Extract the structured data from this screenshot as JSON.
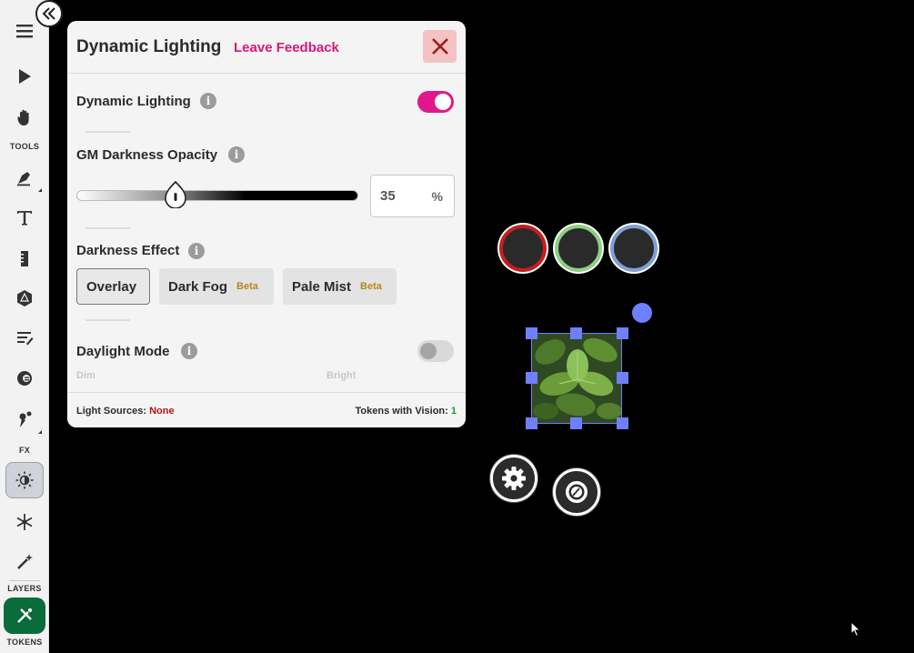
{
  "toolbar": {
    "labels": {
      "tools": "TOOLS",
      "fx": "FX",
      "layers": "LAYERS",
      "tokens": "TOKENS"
    }
  },
  "panel": {
    "title": "Dynamic Lighting",
    "feedback": "Leave Feedback",
    "info_glyph": "i",
    "dynamic_lighting": {
      "label": "Dynamic Lighting",
      "enabled": true
    },
    "gm_opacity": {
      "label": "GM Darkness Opacity",
      "value": "35",
      "unit": "%",
      "fraction": 0.35
    },
    "darkness_effect": {
      "label": "Darkness Effect",
      "options": [
        {
          "label": "Overlay",
          "badge": "",
          "selected": true
        },
        {
          "label": "Dark Fog",
          "badge": "Beta",
          "selected": false
        },
        {
          "label": "Pale Mist",
          "badge": "Beta",
          "selected": false
        }
      ]
    },
    "daylight": {
      "label": "Daylight Mode",
      "enabled": false,
      "dim": "Dim",
      "bright": "Bright"
    },
    "footer": {
      "light_sources_label": "Light Sources:",
      "light_sources_value": "None",
      "tokens_vision_label": "Tokens with Vision:",
      "tokens_vision_value": "1"
    }
  },
  "colors": {
    "accent_pink": "#e0198a",
    "feedback_pink": "#d8187a",
    "close_bg": "#f4c2c3",
    "close_x": "#9b1c1c",
    "beta_gold": "#b9861c",
    "none_red": "#b01818",
    "vision_green": "#1a9a3c",
    "selection_blue": "#6f80ff",
    "ring_red": "#c41e1e",
    "ring_green": "#8fcf84",
    "ring_blue": "#7fa0d4"
  },
  "icons": {
    "toolbar": [
      "menu-icon",
      "select-arrow-icon",
      "pan-hand-icon",
      "draw-pen-icon",
      "text-icon",
      "ruler-icon",
      "dice-icon",
      "notes-icon",
      "aura-icon",
      "fx-wand-icon",
      "dynamic-lighting-icon",
      "weather-icon",
      "magic-wand-icon",
      "tokens-layer-icon"
    ],
    "canvas": [
      "settings-gear-icon",
      "token-aura-icon"
    ]
  }
}
